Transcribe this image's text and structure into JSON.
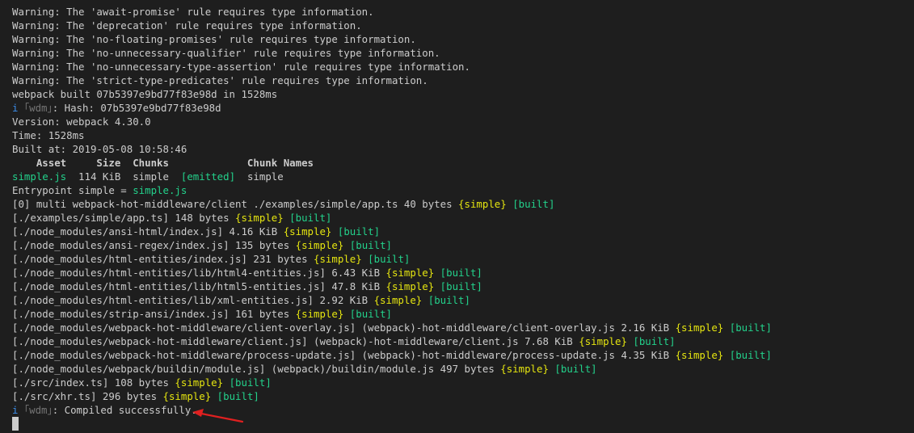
{
  "warnings": [
    "Warning: The 'await-promise' rule requires type information.",
    "Warning: The 'deprecation' rule requires type information.",
    "Warning: The 'no-floating-promises' rule requires type information.",
    "Warning: The 'no-unnecessary-qualifier' rule requires type information.",
    "Warning: The 'no-unnecessary-type-assertion' rule requires type information.",
    "Warning: The 'strict-type-predicates' rule requires type information."
  ],
  "build": {
    "built_line": "webpack built 07b5397e9bd77f83e98d in 1528ms",
    "info_icon": "i",
    "wdm_tag": "｢wdm｣",
    "hash_text": ": Hash: 07b5397e9bd77f83e98d",
    "version": "Version: webpack 4.30.0",
    "time": "Time: 1528ms",
    "built_at": "Built at: 2019-05-08 10:58:46"
  },
  "asset_table": {
    "headers": [
      "Asset",
      "Size",
      "Chunks",
      "",
      "Chunk Names"
    ],
    "header_line": "    Asset     Size  Chunks             Chunk Names",
    "row": {
      "asset": "simple.js",
      "size": "  114 KiB  ",
      "chunks": "simple",
      "emitted": "[emitted]",
      "chunk_name": "simple"
    }
  },
  "entrypoint": {
    "label": "Entrypoint simple = ",
    "file": "simple.js"
  },
  "modules": [
    {
      "path": "[0] multi webpack-hot-middleware/client ./examples/simple/app.ts 40 bytes ",
      "chunk": "{simple}",
      "status": "[built]"
    },
    {
      "path": "[./examples/simple/app.ts] 148 bytes ",
      "chunk": "{simple}",
      "status": "[built]"
    },
    {
      "path": "[./node_modules/ansi-html/index.js] 4.16 KiB ",
      "chunk": "{simple}",
      "status": "[built]"
    },
    {
      "path": "[./node_modules/ansi-regex/index.js] 135 bytes ",
      "chunk": "{simple}",
      "status": "[built]"
    },
    {
      "path": "[./node_modules/html-entities/index.js] 231 bytes ",
      "chunk": "{simple}",
      "status": "[built]"
    },
    {
      "path": "[./node_modules/html-entities/lib/html4-entities.js] 6.43 KiB ",
      "chunk": "{simple}",
      "status": "[built]"
    },
    {
      "path": "[./node_modules/html-entities/lib/html5-entities.js] 47.8 KiB ",
      "chunk": "{simple}",
      "status": "[built]"
    },
    {
      "path": "[./node_modules/html-entities/lib/xml-entities.js] 2.92 KiB ",
      "chunk": "{simple}",
      "status": "[built]"
    },
    {
      "path": "[./node_modules/strip-ansi/index.js] 161 bytes ",
      "chunk": "{simple}",
      "status": "[built]"
    },
    {
      "path": "[./node_modules/webpack-hot-middleware/client-overlay.js] (webpack)-hot-middleware/client-overlay.js 2.16 KiB ",
      "chunk": "{simple}",
      "status": "[built]"
    },
    {
      "path": "[./node_modules/webpack-hot-middleware/client.js] (webpack)-hot-middleware/client.js 7.68 KiB ",
      "chunk": "{simple}",
      "status": "[built]"
    },
    {
      "path": "[./node_modules/webpack-hot-middleware/process-update.js] (webpack)-hot-middleware/process-update.js 4.35 KiB ",
      "chunk": "{simple}",
      "status": "[built]"
    },
    {
      "path": "[./node_modules/webpack/buildin/module.js] (webpack)/buildin/module.js 497 bytes ",
      "chunk": "{simple}",
      "status": "[built]"
    },
    {
      "path": "[./src/index.ts] 108 bytes ",
      "chunk": "{simple}",
      "status": "[built]"
    },
    {
      "path": "[./src/xhr.ts] 296 bytes ",
      "chunk": "{simple}",
      "status": "[built]"
    }
  ],
  "final": {
    "info_icon": "i",
    "wdm_tag": "｢wdm｣",
    "message": ": Compiled successfully."
  },
  "annotation": {
    "icon": "red-arrow-icon",
    "color": "#e02020"
  },
  "colors": {
    "background": "#1e1e1e",
    "text": "#cccccc",
    "green": "#23d18b",
    "yellow": "#e5e510",
    "blue": "#3b8eea"
  }
}
